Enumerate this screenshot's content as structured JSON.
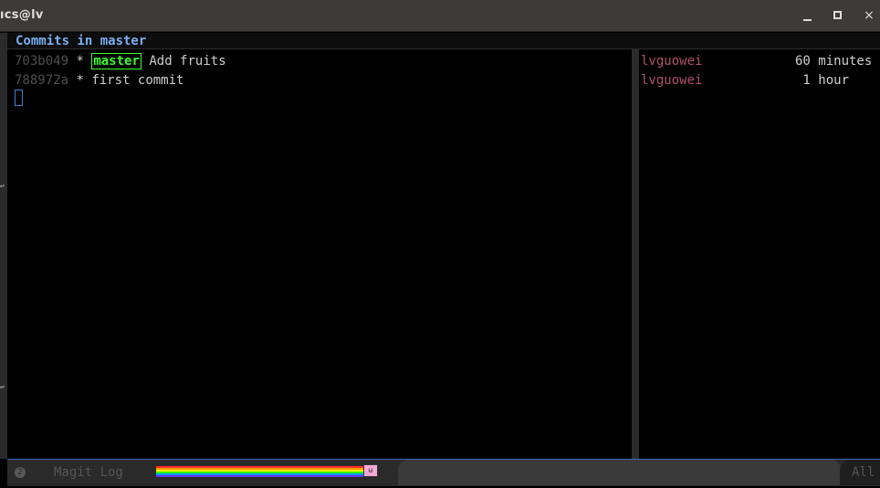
{
  "window": {
    "title": "ıcs@lv",
    "minimize_label": "",
    "maximize_label": "",
    "close_label": "×"
  },
  "header": {
    "text": "Commits in master"
  },
  "commits": [
    {
      "hash": "703b049",
      "graph": "*",
      "branch": "master",
      "message": "Add fruits",
      "author": "lvguowei",
      "date": "60 minutes"
    },
    {
      "hash": "788972a",
      "graph": "*",
      "branch": "",
      "message": "first commit",
      "author": "lvguowei",
      "date": " 1 hour"
    }
  ],
  "modeline": {
    "window_number": "2",
    "mode": "Magit Log",
    "position": "All",
    "rainbow_colors": [
      "#ff2a2a",
      "#ff9a00",
      "#ffee00",
      "#33ff00",
      "#0099ff",
      "#6633ff"
    ]
  },
  "colors": {
    "header": "#79aef0",
    "branch": "#3cfc2c",
    "author": "#b0506a",
    "accent": "#3b66c8"
  }
}
